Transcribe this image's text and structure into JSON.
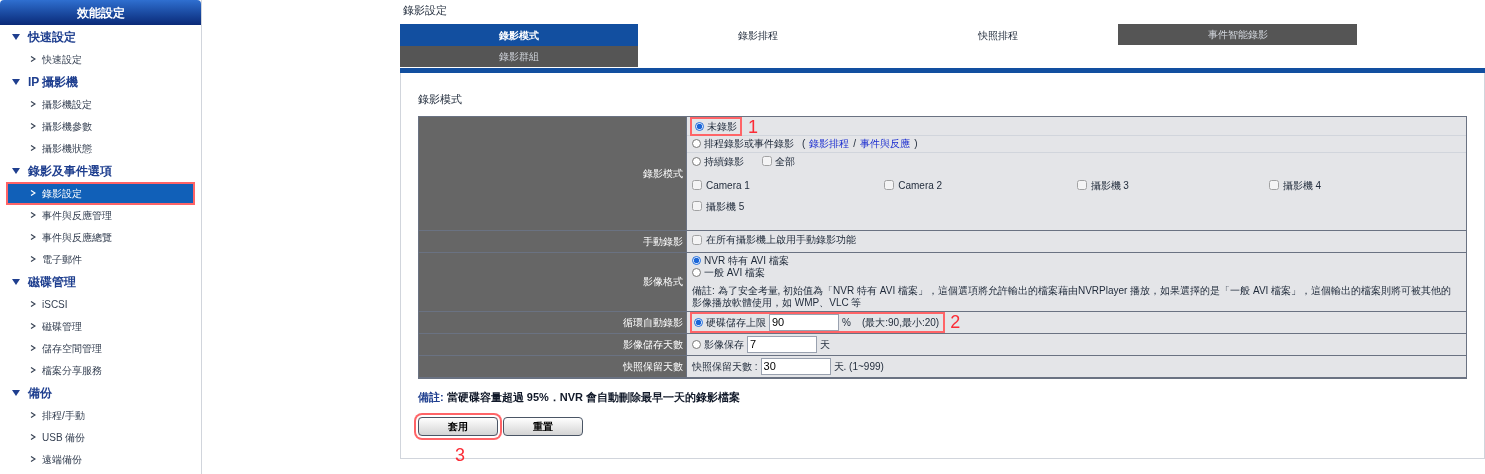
{
  "sidebar": {
    "title": "效能設定",
    "groups": [
      {
        "label": "快速設定",
        "expanded": true,
        "children": [
          {
            "label": "快速設定",
            "selected": false
          }
        ]
      },
      {
        "label": "IP 攝影機",
        "expanded": true,
        "children": [
          {
            "label": "攝影機設定",
            "selected": false
          },
          {
            "label": "攝影機參數",
            "selected": false
          },
          {
            "label": "攝影機狀態",
            "selected": false
          }
        ]
      },
      {
        "label": "錄影及事件選項",
        "expanded": true,
        "children": [
          {
            "label": "錄影設定",
            "selected": true
          },
          {
            "label": "事件與反應管理",
            "selected": false
          },
          {
            "label": "事件與反應總覽",
            "selected": false
          },
          {
            "label": "電子郵件",
            "selected": false
          }
        ]
      },
      {
        "label": "磁碟管理",
        "expanded": true,
        "children": [
          {
            "label": "iSCSI",
            "selected": false
          },
          {
            "label": "磁碟管理",
            "selected": false
          },
          {
            "label": "儲存空間管理",
            "selected": false
          },
          {
            "label": "檔案分享服務",
            "selected": false
          }
        ]
      },
      {
        "label": "備份",
        "expanded": true,
        "children": [
          {
            "label": "排程/手動",
            "selected": false
          },
          {
            "label": "USB 備份",
            "selected": false
          },
          {
            "label": "遠端備份",
            "selected": false
          }
        ]
      }
    ]
  },
  "page_title": "錄影設定",
  "tabs": [
    {
      "label": "錄影模式",
      "selected": true,
      "disabled": false
    },
    {
      "label": "錄影排程",
      "selected": false,
      "disabled": false
    },
    {
      "label": "快照排程",
      "selected": false,
      "disabled": false
    },
    {
      "label": "事件智能錄影",
      "selected": false,
      "disabled": true
    },
    {
      "label": "錄影群組",
      "selected": false,
      "disabled": true
    }
  ],
  "panel": {
    "heading": "錄影模式",
    "rows": [
      {
        "kind": "mode",
        "label": "錄影模式",
        "options": [
          {
            "label": "未錄影",
            "selected": true,
            "callout": "1"
          },
          {
            "label": "排程錄影或事件錄影",
            "selected": false,
            "links": {
              "open": "(",
              "items": [
                "錄影排程",
                "事件與反應"
              ],
              "separator": "/",
              "close": ")"
            }
          },
          {
            "label": "持續錄影",
            "selected": false,
            "all": {
              "label": "全部",
              "checked": false
            }
          }
        ],
        "cameras": [
          {
            "label": "Camera 1",
            "checked": false
          },
          {
            "label": "Camera 2",
            "checked": false
          },
          {
            "label": "攝影機 3",
            "checked": false
          },
          {
            "label": "攝影機 4",
            "checked": false
          },
          {
            "label": "攝影機 5",
            "checked": false
          }
        ]
      },
      {
        "kind": "checkbox",
        "label": "手動錄影",
        "option": {
          "label": "在所有攝影機上啟用手動錄影功能",
          "checked": false
        }
      },
      {
        "kind": "format",
        "label": "影像格式",
        "options": [
          {
            "label": "NVR 特有 AVI 檔案",
            "selected": true
          },
          {
            "label": "一般 AVI 檔案",
            "selected": false
          }
        ],
        "note": "備註: 為了安全考量, 初始值為「NVR 特有 AVI 檔案」，這個選項將允許輸出的檔案藉由NVRPlayer 播放，如果選擇的是「一般 AVI 檔案」，這個輸出的檔案則將可被其他的影像播放軟體使用，如 WMP、VLC 等"
      },
      {
        "kind": "radio_input",
        "label": "循環自動錄影",
        "option": {
          "label": "硬碟儲存上限",
          "selected": true
        },
        "value": "90",
        "unit": "%",
        "hint": "(最大:90,最小:20)",
        "callout": "2"
      },
      {
        "kind": "radio_input",
        "label": "影像儲存天數",
        "option": {
          "label": "影像保存",
          "selected": false
        },
        "value": "7",
        "unit": "天"
      },
      {
        "kind": "input",
        "label": "快照保留天數",
        "prefix": "快照保留天數 :",
        "value": "30",
        "unit": "天. (1~999)"
      }
    ],
    "remark": "**備註:** 當硬碟容量超過 95%．NVR 會自動刪除最早一天的錄影檔案",
    "buttons": [
      {
        "label": "套用",
        "callout": "3"
      },
      {
        "label": "重置"
      }
    ]
  }
}
